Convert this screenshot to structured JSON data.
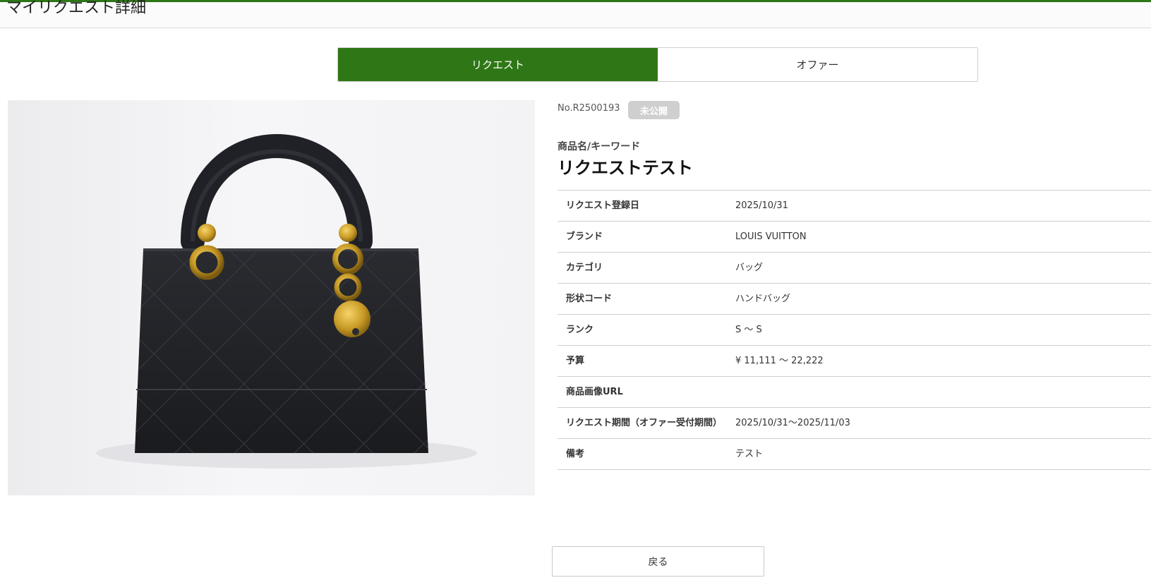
{
  "header": {
    "title": "マイリクエスト詳細"
  },
  "tabs": [
    {
      "label": "リクエスト",
      "active": true
    },
    {
      "label": "オファー",
      "active": false
    }
  ],
  "request": {
    "number": "No.R2500193",
    "status": "未公開",
    "keyword_label": "商品名/キーワード",
    "product_name": "リクエストテスト"
  },
  "details": [
    {
      "label": "リクエスト登録日",
      "value": "2025/10/31"
    },
    {
      "label": "ブランド",
      "value": "LOUIS VUITTON"
    },
    {
      "label": "カテゴリ",
      "value": "バッグ"
    },
    {
      "label": "形状コード",
      "value": "ハンドバッグ"
    },
    {
      "label": "ランク",
      "value": "S 〜 S"
    },
    {
      "label": "予算",
      "value": "¥ 11,111 〜 22,222"
    },
    {
      "label": "商品画像URL",
      "value": ""
    },
    {
      "label": "リクエスト期間（オファー受付期間）",
      "value": "2025/10/31〜2025/11/03"
    },
    {
      "label": "備考",
      "value": "テスト"
    }
  ],
  "footer": {
    "back_label": "戻る"
  },
  "colors": {
    "accent": "#2f7716",
    "badge": "#cfcfcf"
  }
}
